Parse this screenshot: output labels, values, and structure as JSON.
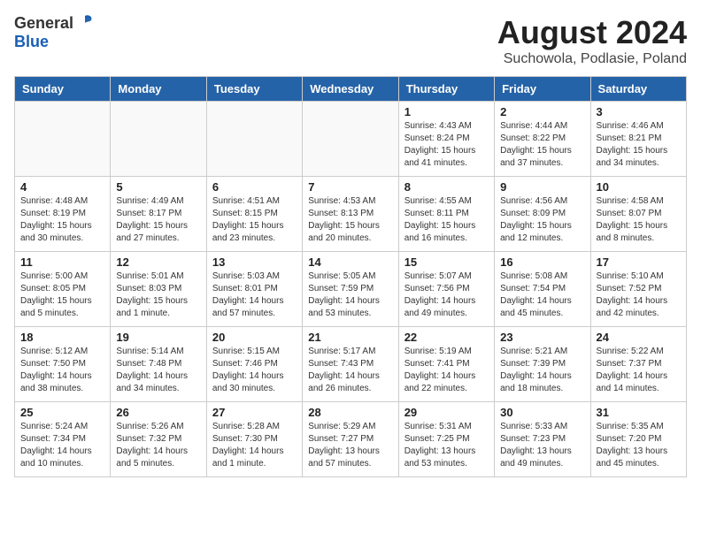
{
  "header": {
    "logo_general": "General",
    "logo_blue": "Blue",
    "month_year": "August 2024",
    "location": "Suchowola, Podlasie, Poland"
  },
  "weekdays": [
    "Sunday",
    "Monday",
    "Tuesday",
    "Wednesday",
    "Thursday",
    "Friday",
    "Saturday"
  ],
  "weeks": [
    [
      {
        "day": "",
        "info": ""
      },
      {
        "day": "",
        "info": ""
      },
      {
        "day": "",
        "info": ""
      },
      {
        "day": "",
        "info": ""
      },
      {
        "day": "1",
        "info": "Sunrise: 4:43 AM\nSunset: 8:24 PM\nDaylight: 15 hours\nand 41 minutes."
      },
      {
        "day": "2",
        "info": "Sunrise: 4:44 AM\nSunset: 8:22 PM\nDaylight: 15 hours\nand 37 minutes."
      },
      {
        "day": "3",
        "info": "Sunrise: 4:46 AM\nSunset: 8:21 PM\nDaylight: 15 hours\nand 34 minutes."
      }
    ],
    [
      {
        "day": "4",
        "info": "Sunrise: 4:48 AM\nSunset: 8:19 PM\nDaylight: 15 hours\nand 30 minutes."
      },
      {
        "day": "5",
        "info": "Sunrise: 4:49 AM\nSunset: 8:17 PM\nDaylight: 15 hours\nand 27 minutes."
      },
      {
        "day": "6",
        "info": "Sunrise: 4:51 AM\nSunset: 8:15 PM\nDaylight: 15 hours\nand 23 minutes."
      },
      {
        "day": "7",
        "info": "Sunrise: 4:53 AM\nSunset: 8:13 PM\nDaylight: 15 hours\nand 20 minutes."
      },
      {
        "day": "8",
        "info": "Sunrise: 4:55 AM\nSunset: 8:11 PM\nDaylight: 15 hours\nand 16 minutes."
      },
      {
        "day": "9",
        "info": "Sunrise: 4:56 AM\nSunset: 8:09 PM\nDaylight: 15 hours\nand 12 minutes."
      },
      {
        "day": "10",
        "info": "Sunrise: 4:58 AM\nSunset: 8:07 PM\nDaylight: 15 hours\nand 8 minutes."
      }
    ],
    [
      {
        "day": "11",
        "info": "Sunrise: 5:00 AM\nSunset: 8:05 PM\nDaylight: 15 hours\nand 5 minutes."
      },
      {
        "day": "12",
        "info": "Sunrise: 5:01 AM\nSunset: 8:03 PM\nDaylight: 15 hours\nand 1 minute."
      },
      {
        "day": "13",
        "info": "Sunrise: 5:03 AM\nSunset: 8:01 PM\nDaylight: 14 hours\nand 57 minutes."
      },
      {
        "day": "14",
        "info": "Sunrise: 5:05 AM\nSunset: 7:59 PM\nDaylight: 14 hours\nand 53 minutes."
      },
      {
        "day": "15",
        "info": "Sunrise: 5:07 AM\nSunset: 7:56 PM\nDaylight: 14 hours\nand 49 minutes."
      },
      {
        "day": "16",
        "info": "Sunrise: 5:08 AM\nSunset: 7:54 PM\nDaylight: 14 hours\nand 45 minutes."
      },
      {
        "day": "17",
        "info": "Sunrise: 5:10 AM\nSunset: 7:52 PM\nDaylight: 14 hours\nand 42 minutes."
      }
    ],
    [
      {
        "day": "18",
        "info": "Sunrise: 5:12 AM\nSunset: 7:50 PM\nDaylight: 14 hours\nand 38 minutes."
      },
      {
        "day": "19",
        "info": "Sunrise: 5:14 AM\nSunset: 7:48 PM\nDaylight: 14 hours\nand 34 minutes."
      },
      {
        "day": "20",
        "info": "Sunrise: 5:15 AM\nSunset: 7:46 PM\nDaylight: 14 hours\nand 30 minutes."
      },
      {
        "day": "21",
        "info": "Sunrise: 5:17 AM\nSunset: 7:43 PM\nDaylight: 14 hours\nand 26 minutes."
      },
      {
        "day": "22",
        "info": "Sunrise: 5:19 AM\nSunset: 7:41 PM\nDaylight: 14 hours\nand 22 minutes."
      },
      {
        "day": "23",
        "info": "Sunrise: 5:21 AM\nSunset: 7:39 PM\nDaylight: 14 hours\nand 18 minutes."
      },
      {
        "day": "24",
        "info": "Sunrise: 5:22 AM\nSunset: 7:37 PM\nDaylight: 14 hours\nand 14 minutes."
      }
    ],
    [
      {
        "day": "25",
        "info": "Sunrise: 5:24 AM\nSunset: 7:34 PM\nDaylight: 14 hours\nand 10 minutes."
      },
      {
        "day": "26",
        "info": "Sunrise: 5:26 AM\nSunset: 7:32 PM\nDaylight: 14 hours\nand 5 minutes."
      },
      {
        "day": "27",
        "info": "Sunrise: 5:28 AM\nSunset: 7:30 PM\nDaylight: 14 hours\nand 1 minute."
      },
      {
        "day": "28",
        "info": "Sunrise: 5:29 AM\nSunset: 7:27 PM\nDaylight: 13 hours\nand 57 minutes."
      },
      {
        "day": "29",
        "info": "Sunrise: 5:31 AM\nSunset: 7:25 PM\nDaylight: 13 hours\nand 53 minutes."
      },
      {
        "day": "30",
        "info": "Sunrise: 5:33 AM\nSunset: 7:23 PM\nDaylight: 13 hours\nand 49 minutes."
      },
      {
        "day": "31",
        "info": "Sunrise: 5:35 AM\nSunset: 7:20 PM\nDaylight: 13 hours\nand 45 minutes."
      }
    ]
  ]
}
